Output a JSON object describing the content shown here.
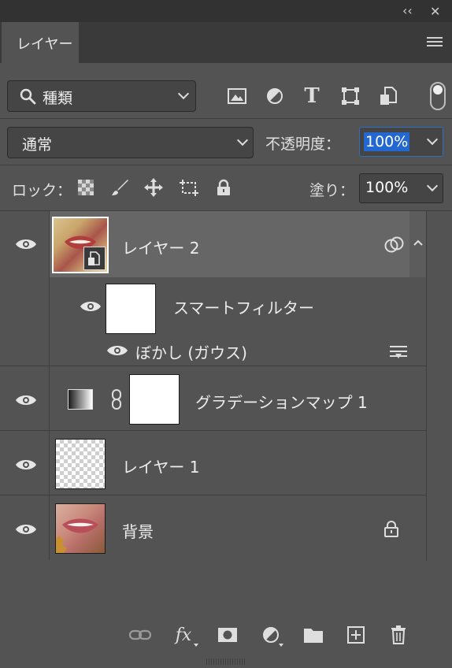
{
  "window": {
    "collapse_icon": "double-chevron-left-icon",
    "close_icon": "close-icon",
    "collapse_glyph": "‹‹",
    "close_glyph": "✕"
  },
  "panel": {
    "tab_title": "レイヤー",
    "menu_icon": "hamburger-menu-icon"
  },
  "filter": {
    "kind_label": "種類",
    "icons": [
      "image-filter-icon",
      "adjustment-filter-icon",
      "type-filter-icon",
      "shape-filter-icon",
      "smart-object-filter-icon"
    ],
    "type_glyph": "T"
  },
  "blend": {
    "mode": "通常",
    "opacity_label": "不透明度：",
    "opacity_value": "100%"
  },
  "lock": {
    "label": "ロック：",
    "fill_label": "塗り：",
    "fill_value": "100%"
  },
  "layers": [
    {
      "name": "レイヤー 2",
      "type": "smart-object",
      "visible": true,
      "selected": true
    },
    {
      "smart_filters_label": "スマートフィルター",
      "filter_name": "ぼかし (ガウス)"
    },
    {
      "name": "グラデーションマップ 1",
      "type": "adjustment",
      "visible": true
    },
    {
      "name": "レイヤー 1",
      "type": "empty",
      "visible": true
    },
    {
      "name": "背景",
      "type": "background",
      "visible": true,
      "locked": true
    }
  ],
  "bottom_icons": [
    "link-layers-icon",
    "fx-icon",
    "layer-mask-icon",
    "adjustment-layer-icon",
    "group-folder-icon",
    "new-layer-icon",
    "trash-icon"
  ],
  "bottom_fx_label": "fx",
  "colors": {
    "panel": "#535353",
    "selected_row": "#666666",
    "accent": "#2367d1"
  }
}
